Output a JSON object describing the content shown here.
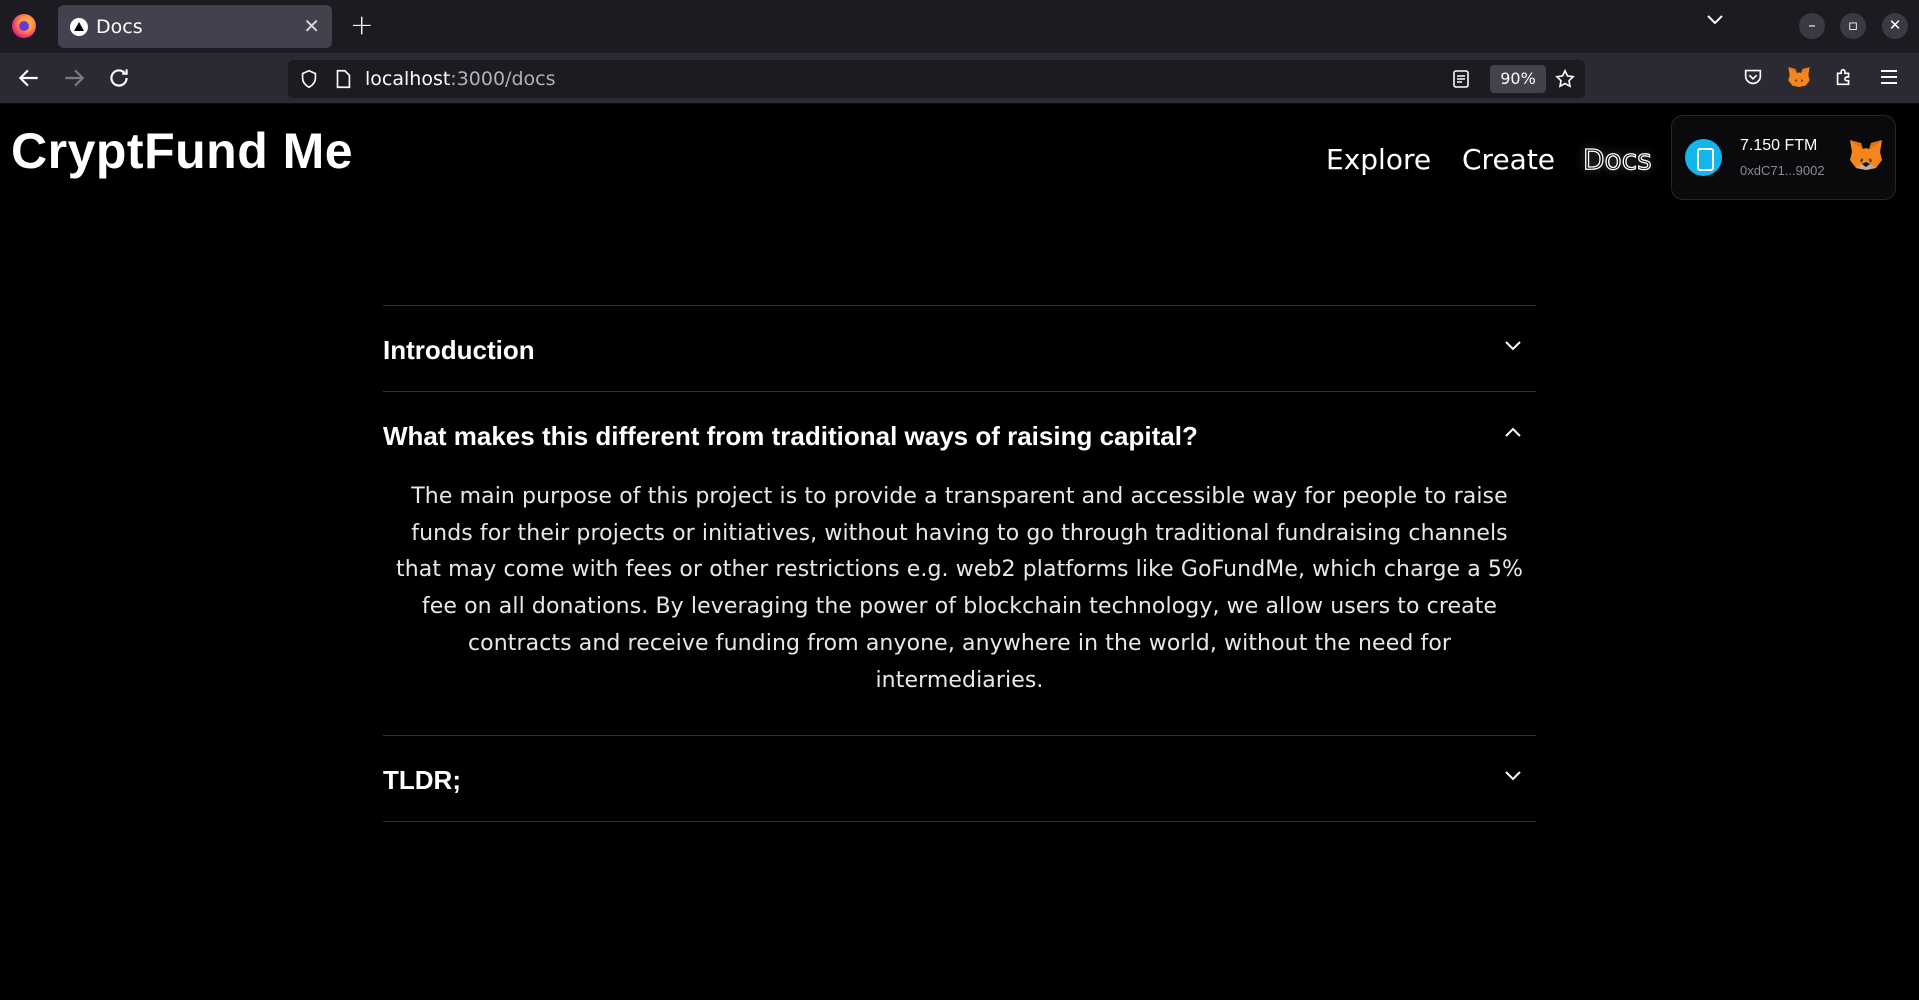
{
  "browser": {
    "tab_title": "Docs",
    "tab_close": "✕",
    "new_tab": "+",
    "url_host": "localhost",
    "url_path": ":3000/docs",
    "zoom": "90%"
  },
  "site": {
    "title": "CryptFund Me",
    "nav": {
      "explore": "Explore",
      "create": "Create",
      "docs": "Docs"
    },
    "wallet": {
      "balance": "7.150 FTM",
      "address": "0xdC71...9002"
    }
  },
  "accordion": {
    "items": [
      {
        "title": "Introduction",
        "expanded": false,
        "body": ""
      },
      {
        "title": "What makes this different from traditional ways of raising capital?",
        "expanded": true,
        "body": "The main purpose of this project is to provide a transparent and accessible way for people to raise funds for their projects or initiatives, without having to go through traditional fundraising channels that may come with fees or other restrictions e.g. web2 platforms like GoFundMe, which charge a 5% fee on all donations. By leveraging the power of blockchain technology, we allow users to create contracts and receive funding from anyone, anywhere in the world, without the need for intermediaries."
      },
      {
        "title": "TLDR;",
        "expanded": false,
        "body": ""
      }
    ]
  },
  "colors": {
    "page_bg": "#000000",
    "chrome_dark": "#1c1b22",
    "chrome_toolbar": "#2b2a33",
    "fantom_blue": "#13b5ec",
    "metamask_orange": "#e2761b"
  }
}
